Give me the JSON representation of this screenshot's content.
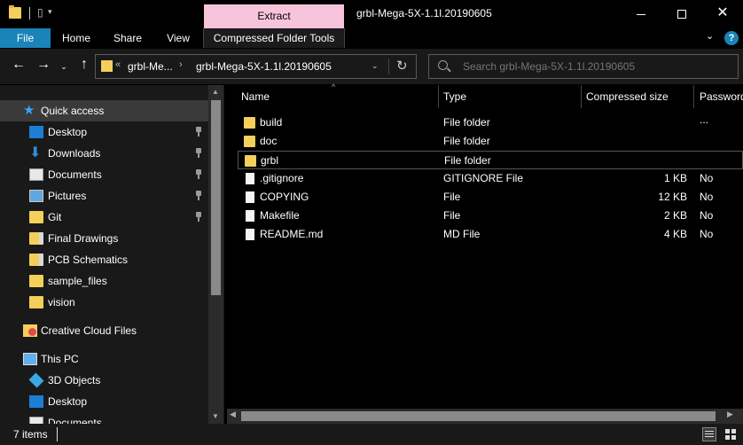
{
  "window": {
    "title": "grbl-Mega-5X-1.1l.20190605",
    "context_tab": "Extract",
    "minimize": "",
    "maximize": "",
    "close": "✕"
  },
  "ribbon": {
    "tabs": [
      "File",
      "Home",
      "Share",
      "View",
      "Compressed Folder Tools"
    ],
    "help": "?",
    "collapse": "⌄"
  },
  "address": {
    "overflow": "«",
    "crumbs": [
      "grbl-Me...",
      "grbl-Mega-5X-1.1l.20190605"
    ],
    "separator": "›",
    "dropdown": "⌄",
    "refresh": "↻"
  },
  "search": {
    "placeholder": "Search grbl-Mega-5X-1.1l.20190605"
  },
  "nav": {
    "back": "←",
    "forward": "→",
    "recent": "⌄",
    "up": "↑",
    "expand": "›",
    "quick_access": "Quick access",
    "items": [
      {
        "label": "Desktop",
        "icon": "desktop-icon",
        "pinned": true
      },
      {
        "label": "Downloads",
        "icon": "download-icon",
        "pinned": true
      },
      {
        "label": "Documents",
        "icon": "documents-icon",
        "pinned": true
      },
      {
        "label": "Pictures",
        "icon": "pictures-icon",
        "pinned": true
      },
      {
        "label": "Git",
        "icon": "folder-icon",
        "pinned": true
      },
      {
        "label": "Final Drawings",
        "icon": "folder-icon",
        "pinned": false
      },
      {
        "label": "PCB Schematics",
        "icon": "folder-icon",
        "pinned": false
      },
      {
        "label": "sample_files",
        "icon": "folder-icon",
        "pinned": false
      },
      {
        "label": "vision",
        "icon": "folder-icon",
        "pinned": false
      }
    ],
    "creative_cloud": "Creative Cloud Files",
    "this_pc": "This PC",
    "pc_items": [
      {
        "label": "3D Objects",
        "icon": "3d-objects-icon"
      },
      {
        "label": "Desktop",
        "icon": "desktop-icon"
      },
      {
        "label": "Documents",
        "icon": "documents-icon"
      }
    ],
    "scroll_up": "▲",
    "scroll_down": "▼"
  },
  "columns": {
    "name": "Name",
    "type": "Type",
    "size": "Compressed size",
    "password": "Password ...",
    "sort": "^"
  },
  "files": [
    {
      "name": "build",
      "type": "File folder",
      "size": "",
      "password": "",
      "kind": "folder"
    },
    {
      "name": "doc",
      "type": "File folder",
      "size": "",
      "password": "",
      "kind": "folder"
    },
    {
      "name": "grbl",
      "type": "File folder",
      "size": "",
      "password": "",
      "kind": "folder",
      "focused": true
    },
    {
      "name": ".gitignore",
      "type": "GITIGNORE File",
      "size": "1 KB",
      "password": "No",
      "kind": "file"
    },
    {
      "name": "COPYING",
      "type": "File",
      "size": "12 KB",
      "password": "No",
      "kind": "file"
    },
    {
      "name": "Makefile",
      "type": "File",
      "size": "2 KB",
      "password": "No",
      "kind": "file"
    },
    {
      "name": "README.md",
      "type": "MD File",
      "size": "4 KB",
      "password": "No",
      "kind": "file"
    }
  ],
  "hscroll": {
    "left": "◀",
    "right": "▶"
  },
  "status": {
    "item_count": "7 items"
  },
  "colors": {
    "accent": "#1a84b8",
    "context_tab": "#f7c4dc",
    "folder": "#f4cf5c"
  }
}
